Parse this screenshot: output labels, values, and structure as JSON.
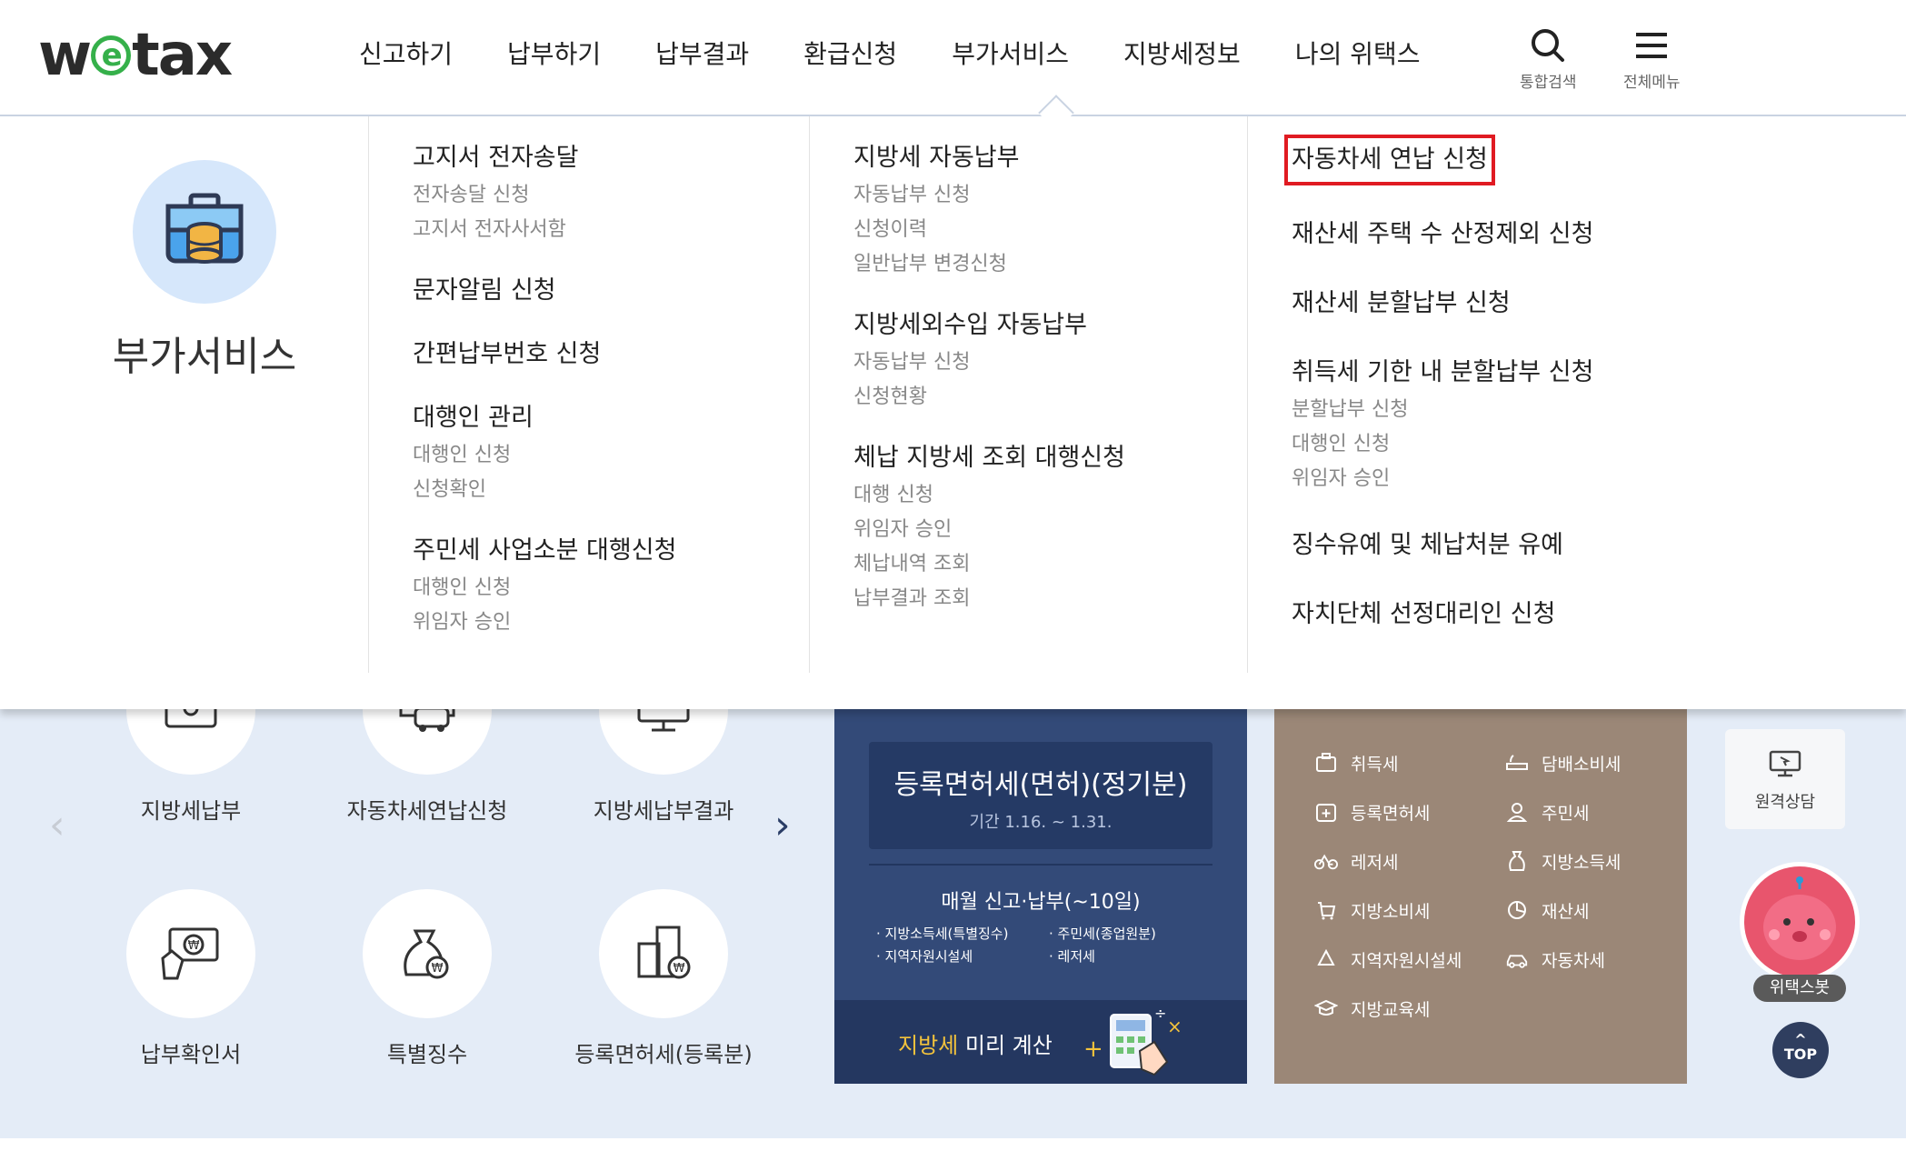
{
  "header": {
    "logo_pre": "w",
    "logo_e": "e",
    "logo_post": "tax",
    "nav": [
      "신고하기",
      "납부하기",
      "납부결과",
      "환급신청",
      "부가서비스",
      "지방세정보",
      "나의 위택스"
    ],
    "search_label": "통합검색",
    "menu_label": "전체메뉴"
  },
  "mega": {
    "title": "부가서비스",
    "col1": [
      {
        "title": "고지서 전자송달",
        "subs": [
          "전자송달 신청",
          "고지서 전자사서함"
        ]
      },
      {
        "title": "문자알림 신청",
        "subs": []
      },
      {
        "title": "간편납부번호 신청",
        "subs": []
      },
      {
        "title": "대행인 관리",
        "subs": [
          "대행인 신청",
          "신청확인"
        ]
      },
      {
        "title": "주민세 사업소분 대행신청",
        "subs": [
          "대행인 신청",
          "위임자 승인"
        ]
      }
    ],
    "col2": [
      {
        "title": "지방세 자동납부",
        "subs": [
          "자동납부 신청",
          "신청이력",
          "일반납부 변경신청"
        ]
      },
      {
        "title": "지방세외수입 자동납부",
        "subs": [
          "자동납부 신청",
          "신청현황"
        ]
      },
      {
        "title": "체납 지방세 조회 대행신청",
        "subs": [
          "대행 신청",
          "위임자 승인",
          "체납내역 조회",
          "납부결과 조회"
        ]
      }
    ],
    "col3": [
      {
        "title": "자동차세 연납 신청",
        "subs": []
      },
      {
        "title": "재산세 주택 수 산정제외 신청",
        "subs": []
      },
      {
        "title": "재산세 분할납부 신청",
        "subs": []
      },
      {
        "title": "취득세 기한 내 분할납부 신청",
        "subs": [
          "분할납부 신청",
          "대행인 신청",
          "위임자 승인"
        ]
      },
      {
        "title": "징수유예 및 체납처분 유예",
        "subs": []
      },
      {
        "title": "자치단체 선정대리인 신청",
        "subs": []
      }
    ]
  },
  "services": {
    "row1": [
      "지방세납부",
      "자동차세연납신청",
      "지방세납부결과"
    ],
    "row2": [
      "납부확인서",
      "특별징수",
      "등록면허세(등록분)"
    ]
  },
  "notice": {
    "title": "등록면허세(면허)(정기분)",
    "period": "기간 1.16. ~ 1.31.",
    "monthly": "매월 신고·납부(~10일)",
    "items": [
      "지방소득세(특별징수)",
      "주민세(종업원분)",
      "지역자원시설세",
      "레저세"
    ],
    "calc_highlight": "지방세",
    "calc_rest": " 미리 계산"
  },
  "taxes": [
    "취득세",
    "담배소비세",
    "등록면허세",
    "주민세",
    "레저세",
    "지방소득세",
    "지방소비세",
    "재산세",
    "지역자원시설세",
    "자동차세",
    "지방교육세"
  ],
  "side": {
    "remote": "원격상담",
    "bot": "위택스봇",
    "top": "TOP"
  },
  "colors": {
    "highlight": "#e01b22",
    "logo_green": "#35b04a",
    "notice_blue": "#334a78",
    "tax_brown": "#9b8777"
  }
}
